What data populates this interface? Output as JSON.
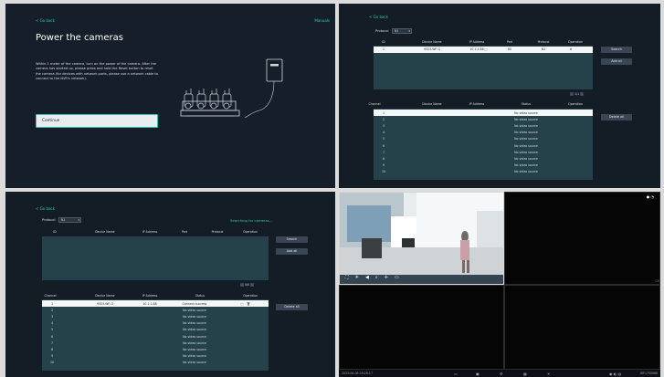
{
  "screen1": {
    "back": "< Go back",
    "manuals": "Manuals",
    "title": "Power the cameras",
    "description": "Within 1 meter of the camera, turn on the power of the camera. After the camera has started up, please press and hold the Reset button to reset the camera (for devices with network ports, please use a network cable to connect to the NVR's network).",
    "continue_label": "Continue"
  },
  "screen2": {
    "back": "< Go back",
    "protocol_label": "Protocol",
    "protocol_value": "N1",
    "columns": [
      "ID",
      "Device Name",
      "IP Address",
      "Port",
      "Protocol",
      "Operation"
    ],
    "device": {
      "id": "1",
      "name": "9323-WF-G",
      "ip": "10.1.1.88",
      "port": "80",
      "protocol": "N1"
    },
    "search_label": "Search",
    "add_all_label": "Add all",
    "pager": "1/1",
    "channel_columns": [
      "Channel",
      "Device Name",
      "IP Address",
      "Status",
      "Operation"
    ],
    "channels": [
      "1",
      "2",
      "3",
      "4",
      "5",
      "6",
      "7",
      "8",
      "9",
      "10"
    ],
    "status_text": "No video source",
    "delete_all_label": "Delete all"
  },
  "screen3": {
    "back": "< Go back",
    "protocol_label": "Protocol",
    "protocol_value": "N1",
    "searching": "Searching for cameras...",
    "columns": [
      "ID",
      "Device Name",
      "IP Address",
      "Port",
      "Protocol",
      "Operation"
    ],
    "search_label": "Search",
    "add_all_label": "Add all",
    "pager": "0/0",
    "channel_columns": [
      "Channel",
      "Device Name",
      "IP Address",
      "Status",
      "Operation"
    ],
    "channel1": {
      "name": "9323-WF-G",
      "ip": "10.1.1.88",
      "status": "Connect success"
    },
    "channels": [
      "1",
      "2",
      "3",
      "4",
      "5",
      "6",
      "7",
      "8",
      "9",
      "10"
    ],
    "status_text": "No video source",
    "delete_all_label": "Delete all"
  },
  "screen4": {
    "timestamp": "2023-06-08 16:26:17",
    "right_label": "CH",
    "id_label": "WF17SS988"
  }
}
